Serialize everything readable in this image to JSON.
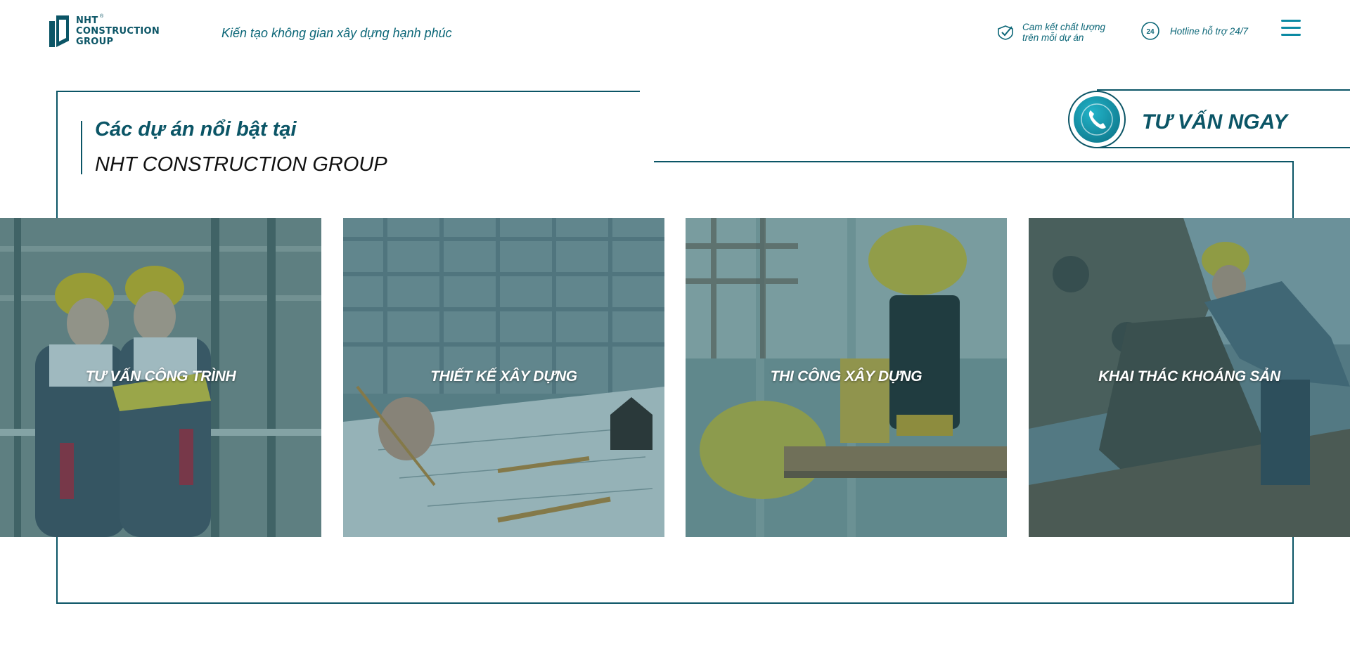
{
  "header": {
    "logo_lines": [
      "NHT",
      "CONSTRUCTION",
      "GROUP"
    ],
    "logo_registered": "®",
    "tagline": "Kiến tạo không gian xây dựng hạnh phúc",
    "commitment": {
      "line1": "Cam kết chất lượng",
      "line2": "trên mỗi dự án",
      "icon": "check-shield-icon"
    },
    "hotline": {
      "label": "Hotline hỗ trợ 24/7",
      "badge": "24",
      "icon": "support-24-icon"
    },
    "menu_icon": "hamburger-menu-icon"
  },
  "section": {
    "title_line1": "Các dự án nổi bật tại",
    "title_line2": "NHT CONSTRUCTION GROUP"
  },
  "consult": {
    "label": "TƯ VẤN NGAY",
    "icon": "phone-icon"
  },
  "cards": [
    {
      "label": "TƯ VẤN CÔNG TRÌNH"
    },
    {
      "label": "THIẾT KẾ XÂY DỰNG"
    },
    {
      "label": "THI CÔNG XÂY DỰNG"
    },
    {
      "label": "KHAI THÁC KHOÁNG SẢN"
    }
  ],
  "colors": {
    "brand": "#0b5566",
    "accent": "#0b8aa3",
    "overlay": "#0b5566"
  }
}
